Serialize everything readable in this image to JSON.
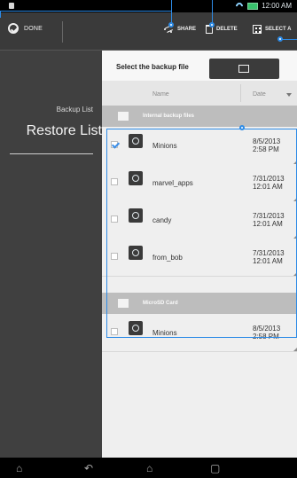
{
  "status": {
    "time": "12:00 AM"
  },
  "actions": {
    "done": "DONE",
    "share": "SHARE",
    "delete": "DELETE",
    "select": "SELECT A"
  },
  "sidebar": {
    "title": "Backup List",
    "active": "Restore List"
  },
  "content": {
    "prompt": "Select the backup file",
    "columns": {
      "name": "Name",
      "date": "Date"
    },
    "groups": [
      {
        "label": "Internal backup files"
      },
      {
        "label": "MicroSD Card"
      }
    ],
    "rows": [
      {
        "name": "Minions",
        "date1": "8/5/2013",
        "date2": "2:58 PM"
      },
      {
        "name": "marvel_apps",
        "date1": "7/31/2013",
        "date2": "12:01 AM"
      },
      {
        "name": "candy",
        "date1": "7/31/2013",
        "date2": "12:01 AM"
      },
      {
        "name": "from_bob",
        "date1": "7/31/2013",
        "date2": "12:01 AM"
      },
      {
        "name": "Minions",
        "date1": "8/5/2013",
        "date2": "2:58 PM"
      }
    ]
  }
}
